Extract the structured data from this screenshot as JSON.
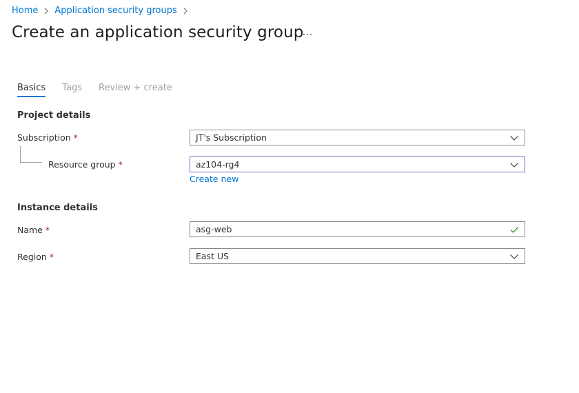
{
  "breadcrumb": {
    "items": [
      "Home",
      "Application security groups"
    ]
  },
  "page": {
    "title": "Create an application security group",
    "more_label": "..."
  },
  "tabs": [
    {
      "label": "Basics",
      "active": true
    },
    {
      "label": "Tags",
      "active": false
    },
    {
      "label": "Review + create",
      "active": false
    }
  ],
  "project_details": {
    "title": "Project details",
    "subscription": {
      "label": "Subscription",
      "value": "JT's Subscription"
    },
    "resource_group": {
      "label": "Resource group",
      "value": "az104-rg4",
      "create_new": "Create new"
    }
  },
  "instance_details": {
    "title": "Instance details",
    "name": {
      "label": "Name",
      "value": "asg-web"
    },
    "region": {
      "label": "Region",
      "value": "East US"
    }
  },
  "required_marker": "*",
  "icons": {
    "chevron": "chevron-down-icon",
    "check": "checkmark-icon",
    "more": "more-horizontal-icon",
    "sep": "chevron-right-icon"
  },
  "colors": {
    "accent": "#0078d4",
    "required": "#a4262c",
    "valid": "#107c10",
    "focus": "#8661c5"
  }
}
